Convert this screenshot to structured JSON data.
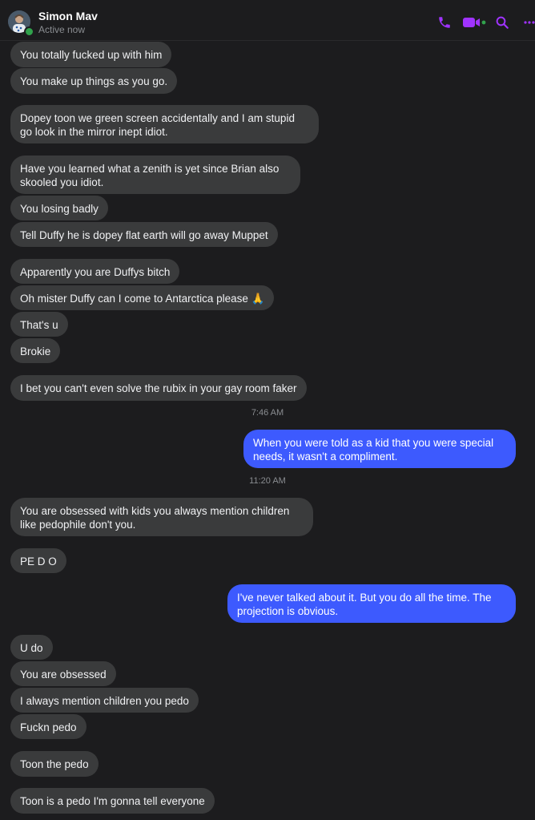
{
  "contact": {
    "name": "Simon Mav",
    "status": "Active now"
  },
  "header_icons": [
    "phone-icon",
    "video-icon",
    "search-icon",
    "more-icon"
  ],
  "colors": {
    "accent": "#a033ff",
    "incoming_bubble": "#3a3b3c",
    "outgoing_bubble": "#3d5afe",
    "presence": "#31a24c"
  },
  "messages": [
    {
      "from": "them",
      "text": "You totally fucked up with him"
    },
    {
      "from": "them",
      "text": "You make up things as you go."
    },
    {
      "from": "them",
      "text": "Dopey toon we green screen accidentally and I am stupid go look in the mirror inept idiot."
    },
    {
      "from": "them",
      "text": "Have you learned what a zenith is yet since Brian also skooled you idiot."
    },
    {
      "from": "them",
      "text": "You losing badly"
    },
    {
      "from": "them",
      "text": "Tell Duffy he is dopey flat earth will go away Muppet"
    },
    {
      "from": "them",
      "text": "Apparently you are Duffys bitch"
    },
    {
      "from": "them",
      "text": "Oh mister Duffy can I come to Antarctica please 🙏"
    },
    {
      "from": "them",
      "text": "That's u"
    },
    {
      "from": "them",
      "text": "Brokie"
    },
    {
      "from": "them",
      "text": "I bet you can't even solve the rubix in your gay room faker"
    },
    {
      "from": "me",
      "text": "When you were told as a kid that you were special needs, it wasn't a compliment."
    },
    {
      "from": "them",
      "text": "You are obsessed with kids you always mention children like pedophile don't you."
    },
    {
      "from": "them",
      "text": "PE D O"
    },
    {
      "from": "me",
      "text": "I've never talked about it. But you do all the time. The projection is obvious."
    },
    {
      "from": "them",
      "text": "U do"
    },
    {
      "from": "them",
      "text": "You are obsessed"
    },
    {
      "from": "them",
      "text": "I always mention children you pedo"
    },
    {
      "from": "them",
      "text": "Fuckn pedo"
    },
    {
      "from": "them",
      "text": "Toon the pedo"
    },
    {
      "from": "them",
      "text": "Toon is a pedo I'm  gonna tell everyone"
    }
  ],
  "timestamps": [
    "7:46 AM",
    "11:20 AM"
  ]
}
